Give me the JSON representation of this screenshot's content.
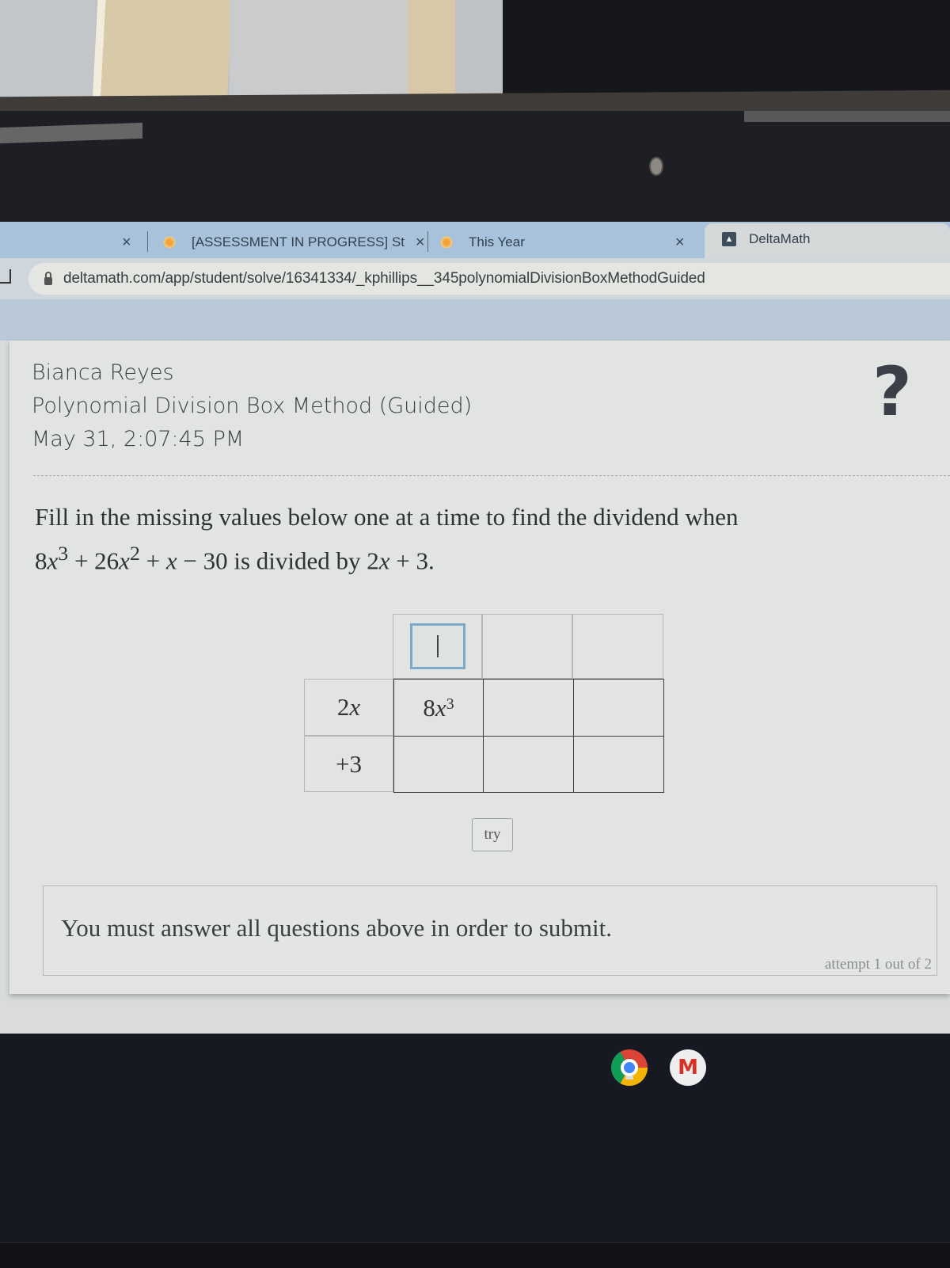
{
  "browser": {
    "tabs": [
      {
        "label": "",
        "close": "×"
      },
      {
        "label": "[ASSESSMENT IN PROGRESS] St",
        "close": "×"
      },
      {
        "label": "This Year",
        "close": "×"
      },
      {
        "label": "DeltaMath",
        "active": true
      }
    ],
    "url": "deltamath.com/app/student/solve/16341334/_kphillips__345polynomialDivisionBoxMethodGuided"
  },
  "header": {
    "student_name": "Bianca Reyes",
    "assignment_title": "Polynomial Division Box Method (Guided)",
    "timestamp": "May 31, 2:07:45 PM",
    "help_glyph": "?"
  },
  "question": {
    "line1": "Fill in the missing values below one at a time to find the dividend when",
    "dividend": {
      "t1": "8",
      "v1": "x",
      "e1": "3",
      "op1": " + ",
      "t2": "26",
      "v2": "x",
      "e2": "2",
      "op2": " + ",
      "v3": "x",
      "op3": " − ",
      "t4": "30"
    },
    "mid": " is divided by ",
    "divisor": {
      "c": "2",
      "v": "x",
      "rest": " + 3."
    }
  },
  "grid": {
    "divisor_terms": [
      {
        "coef": "2",
        "var": "x"
      },
      {
        "coef": "+3",
        "var": ""
      }
    ],
    "quotient_inputs": [
      {
        "value": "",
        "focused": true
      },
      {
        "value": ""
      },
      {
        "value": ""
      }
    ],
    "products": [
      [
        {
          "coef": "8",
          "var": "x",
          "exp": "3"
        },
        {
          "coef": ""
        },
        {
          "coef": ""
        }
      ],
      [
        {
          "coef": ""
        },
        {
          "coef": ""
        },
        {
          "coef": ""
        }
      ]
    ]
  },
  "actions": {
    "try_label": "try"
  },
  "submit": {
    "message": "You must answer all questions above in order to submit.",
    "attempt": "attempt 1 out of 2"
  },
  "shelf": {
    "apps": [
      "Chrome",
      "Gmail"
    ],
    "gmail_glyph": "M"
  }
}
